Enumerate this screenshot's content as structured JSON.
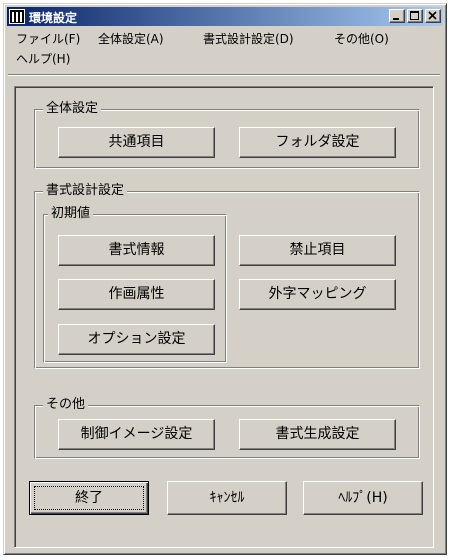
{
  "window": {
    "title": "環境設定",
    "controls": {
      "minimize": "minimize",
      "maximize": "maximize",
      "close": "close"
    }
  },
  "menu": {
    "file": "ファイル(F)",
    "global": "全体設定(A)",
    "format": "書式設計設定(D)",
    "other": "その他(O)",
    "help": "ヘルプ(H)"
  },
  "groups": {
    "global": {
      "label": "全体設定",
      "common_button": "共通項目",
      "folder_button": "フォルダ設定"
    },
    "format": {
      "label": "書式設計設定",
      "initial": {
        "label": "初期値",
        "info_button": "書式情報",
        "draw_attr_button": "作画属性",
        "option_button": "オプション設定"
      },
      "prohibited_button": "禁止項目",
      "gaiji_button": "外字マッピング"
    },
    "other": {
      "label": "その他",
      "control_image_button": "制御イメージ設定",
      "generate_button": "書式生成設定"
    }
  },
  "footer": {
    "exit_button": "終了",
    "cancel_button": "ｷｬﾝｾﾙ",
    "help_button": "ﾍﾙﾌﾟ(H)"
  }
}
